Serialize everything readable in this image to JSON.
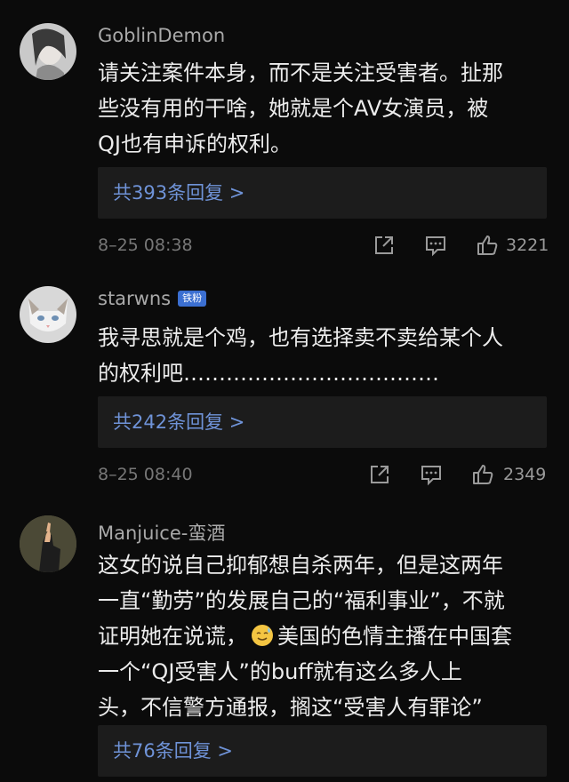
{
  "comments": [
    {
      "username": "GoblinDemon",
      "badge": "",
      "text_lines": [
        "请关注案件本身，而不是关注受害者。扯那",
        "些没有用的干啥，她就是个AV女演员，被",
        "QJ也有申诉的权利。"
      ],
      "replies_label": "共393条回复 >",
      "time": "8–25 08:38",
      "likes": "3221",
      "icons": [
        "share-icon",
        "comment-icon",
        "thumbs-up-icon"
      ]
    },
    {
      "username": "starwns",
      "badge": "铁粉",
      "text_lines": [
        "我寻思就是个鸡，也有选择卖不卖给某个人",
        "的权利吧………………………………"
      ],
      "replies_label": "共242条回复 >",
      "time": "8–25 08:40",
      "likes": "2349",
      "icons": [
        "share-icon",
        "comment-icon",
        "thumbs-up-icon"
      ]
    },
    {
      "username": "Manjuice-蛮酒",
      "badge": "",
      "text_lines": [
        "这女的说自己抑郁想自杀两年，但是这两年",
        "一直“勤劳”的发展自己的“福利事业”，不就"
      ],
      "text_line3_before": "证明她在说谎，",
      "emoji": "sweat-smile-emoji",
      "text_line3_after": "美国的色情主播在中国套",
      "text_lines_tail": [
        "一个“QJ受害人”的buff就有这么多人上",
        "头，不信警方通报，搁这“受害人有罪论”"
      ],
      "replies_label": "共76条回复 >"
    }
  ]
}
